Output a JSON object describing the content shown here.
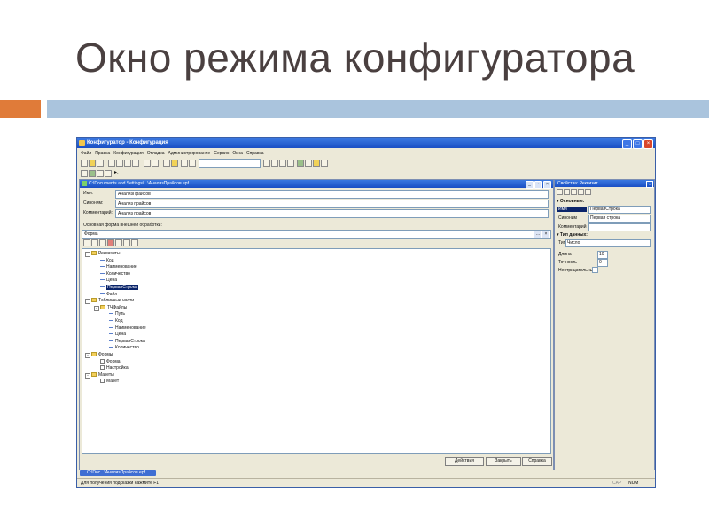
{
  "slide": {
    "title": "Окно режима конфигуратора"
  },
  "app": {
    "title": "Конфигуратор - Конфигурация",
    "menu": [
      "Файл",
      "Правка",
      "Конфигурация",
      "Отладка",
      "Администрирование",
      "Сервис",
      "Окна",
      "Справка"
    ],
    "toolbar_more": "▸."
  },
  "doc": {
    "title": "C:\\Documents and Settings\\...\\АнализПрайсов.epf",
    "fields": [
      {
        "label": "Имя:",
        "value": "АнализПрайсов"
      },
      {
        "label": "Синоним:",
        "value": "Анализ прайсов"
      },
      {
        "label": "Комментарий:",
        "value": "Анализ прайсов"
      }
    ],
    "form_label": "Основная форма внешней обработки:",
    "form_value": "Форма",
    "tree": [
      {
        "text": "Реквизиты",
        "level": 0,
        "kind": "folder",
        "toggle": "−"
      },
      {
        "text": "Код",
        "level": 1,
        "kind": "attr"
      },
      {
        "text": "Наименование",
        "level": 1,
        "kind": "attr"
      },
      {
        "text": "Количество",
        "level": 1,
        "kind": "attr"
      },
      {
        "text": "Цена",
        "level": 1,
        "kind": "attr"
      },
      {
        "text": "ПерваяСтрока",
        "level": 1,
        "kind": "attr",
        "selected": true
      },
      {
        "text": "Файл",
        "level": 1,
        "kind": "attr"
      },
      {
        "text": "Табличные части",
        "level": 0,
        "kind": "folder",
        "toggle": "−"
      },
      {
        "text": "ТЧФайлы",
        "level": 1,
        "kind": "folder",
        "toggle": "−"
      },
      {
        "text": "Путь",
        "level": 2,
        "kind": "attr"
      },
      {
        "text": "Код",
        "level": 2,
        "kind": "attr"
      },
      {
        "text": "Наименование",
        "level": 2,
        "kind": "attr"
      },
      {
        "text": "Цена",
        "level": 2,
        "kind": "attr"
      },
      {
        "text": "ПерваяСтрока",
        "level": 2,
        "kind": "attr"
      },
      {
        "text": "Количество",
        "level": 2,
        "kind": "attr"
      },
      {
        "text": "Формы",
        "level": 0,
        "kind": "folder",
        "toggle": "−"
      },
      {
        "text": "Форма",
        "level": 1,
        "kind": "sq"
      },
      {
        "text": "Настройка",
        "level": 1,
        "kind": "sq"
      },
      {
        "text": "Макеты",
        "level": 0,
        "kind": "folder",
        "toggle": "−"
      },
      {
        "text": "Макет",
        "level": 1,
        "kind": "sq"
      }
    ],
    "buttons": {
      "actions": "Действия",
      "close": "Закрыть",
      "help": "Справка"
    }
  },
  "props": {
    "title": "Свойства: Реквизит",
    "group_basic": "▾ Основные:",
    "rows": [
      {
        "label": "Имя",
        "value": "ПерваяСтрока",
        "highlight": true
      },
      {
        "label": "Синоним",
        "value": "Первая строка"
      },
      {
        "label": "Комментарий",
        "value": ""
      }
    ],
    "group_type": "▾ Тип данных:",
    "type_label": "Тип",
    "type_value": "Число",
    "length_label": "Длина",
    "length_value": "10",
    "precision_label": "Точность",
    "precision_value": "0",
    "nonneg_label": "Неотрицательны"
  },
  "taskbar": {
    "item": "C:\\Doc...\\АнализПрайсов.epf"
  },
  "status": {
    "text": "Для получения подсказки нажмите F1",
    "cap": "CAP",
    "num": "NUM"
  },
  "colors": {
    "accent_orange": "#e07b39",
    "accent_blue": "#aac4dd",
    "title_text": "#4a4040",
    "xp_title": "#1a4fc4"
  }
}
